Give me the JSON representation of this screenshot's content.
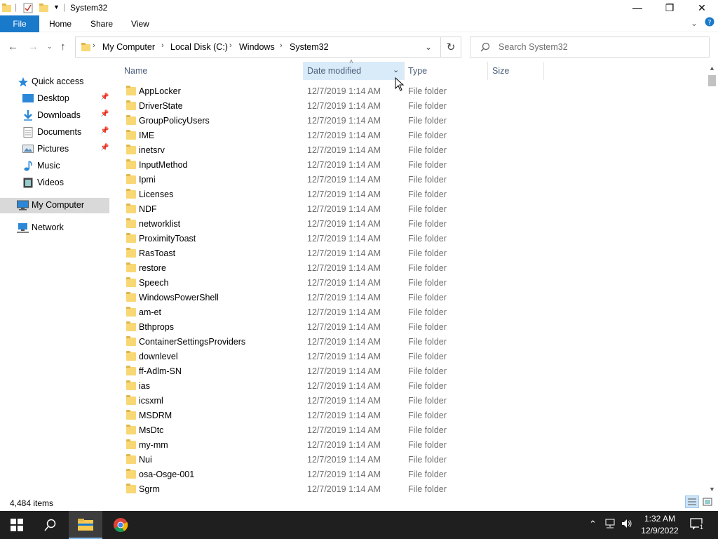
{
  "window": {
    "title": "System32",
    "minimize_label": "—",
    "maximize_label": "❐",
    "close_label": "✕"
  },
  "ribbon": {
    "tabs": [
      "File",
      "Home",
      "Share",
      "View"
    ]
  },
  "address": {
    "crumbs": [
      "My Computer",
      "Local Disk (C:)",
      "Windows",
      "System32"
    ]
  },
  "search": {
    "placeholder": "Search System32"
  },
  "sidebar": {
    "quick_access": "Quick access",
    "items": [
      {
        "label": "Desktop",
        "icon": "desktop-icon",
        "pinned": true
      },
      {
        "label": "Downloads",
        "icon": "downloads-icon",
        "pinned": true
      },
      {
        "label": "Documents",
        "icon": "documents-icon",
        "pinned": true
      },
      {
        "label": "Pictures",
        "icon": "pictures-icon",
        "pinned": true
      },
      {
        "label": "Music",
        "icon": "music-icon",
        "pinned": false
      },
      {
        "label": "Videos",
        "icon": "videos-icon",
        "pinned": false
      }
    ],
    "my_computer": "My Computer",
    "network": "Network"
  },
  "columns": {
    "name": "Name",
    "date": "Date modified",
    "type": "Type",
    "size": "Size"
  },
  "files": [
    {
      "name": "AppLocker",
      "date": "12/7/2019 1:14 AM",
      "type": "File folder"
    },
    {
      "name": "DriverState",
      "date": "12/7/2019 1:14 AM",
      "type": "File folder"
    },
    {
      "name": "GroupPolicyUsers",
      "date": "12/7/2019 1:14 AM",
      "type": "File folder"
    },
    {
      "name": "IME",
      "date": "12/7/2019 1:14 AM",
      "type": "File folder"
    },
    {
      "name": "inetsrv",
      "date": "12/7/2019 1:14 AM",
      "type": "File folder"
    },
    {
      "name": "InputMethod",
      "date": "12/7/2019 1:14 AM",
      "type": "File folder"
    },
    {
      "name": "Ipmi",
      "date": "12/7/2019 1:14 AM",
      "type": "File folder"
    },
    {
      "name": "Licenses",
      "date": "12/7/2019 1:14 AM",
      "type": "File folder"
    },
    {
      "name": "NDF",
      "date": "12/7/2019 1:14 AM",
      "type": "File folder"
    },
    {
      "name": "networklist",
      "date": "12/7/2019 1:14 AM",
      "type": "File folder"
    },
    {
      "name": "ProximityToast",
      "date": "12/7/2019 1:14 AM",
      "type": "File folder"
    },
    {
      "name": "RasToast",
      "date": "12/7/2019 1:14 AM",
      "type": "File folder"
    },
    {
      "name": "restore",
      "date": "12/7/2019 1:14 AM",
      "type": "File folder"
    },
    {
      "name": "Speech",
      "date": "12/7/2019 1:14 AM",
      "type": "File folder"
    },
    {
      "name": "WindowsPowerShell",
      "date": "12/7/2019 1:14 AM",
      "type": "File folder"
    },
    {
      "name": "am-et",
      "date": "12/7/2019 1:14 AM",
      "type": "File folder"
    },
    {
      "name": "Bthprops",
      "date": "12/7/2019 1:14 AM",
      "type": "File folder"
    },
    {
      "name": "ContainerSettingsProviders",
      "date": "12/7/2019 1:14 AM",
      "type": "File folder"
    },
    {
      "name": "downlevel",
      "date": "12/7/2019 1:14 AM",
      "type": "File folder"
    },
    {
      "name": "ff-Adlm-SN",
      "date": "12/7/2019 1:14 AM",
      "type": "File folder"
    },
    {
      "name": "ias",
      "date": "12/7/2019 1:14 AM",
      "type": "File folder"
    },
    {
      "name": "icsxml",
      "date": "12/7/2019 1:14 AM",
      "type": "File folder"
    },
    {
      "name": "MSDRM",
      "date": "12/7/2019 1:14 AM",
      "type": "File folder"
    },
    {
      "name": "MsDtc",
      "date": "12/7/2019 1:14 AM",
      "type": "File folder"
    },
    {
      "name": "my-mm",
      "date": "12/7/2019 1:14 AM",
      "type": "File folder"
    },
    {
      "name": "Nui",
      "date": "12/7/2019 1:14 AM",
      "type": "File folder"
    },
    {
      "name": "osa-Osge-001",
      "date": "12/7/2019 1:14 AM",
      "type": "File folder"
    },
    {
      "name": "Sgrm",
      "date": "12/7/2019 1:14 AM",
      "type": "File folder"
    }
  ],
  "status": {
    "item_count": "4,484 items"
  },
  "taskbar": {
    "time": "1:32 AM",
    "date": "12/9/2022",
    "notification_count": "1"
  },
  "colors": {
    "accent": "#1979ca",
    "selected_nav": "#d9d9d9",
    "sorted_header": "#d9ebf9",
    "folder": "#f8d775",
    "taskbar": "#1f1f1f"
  }
}
